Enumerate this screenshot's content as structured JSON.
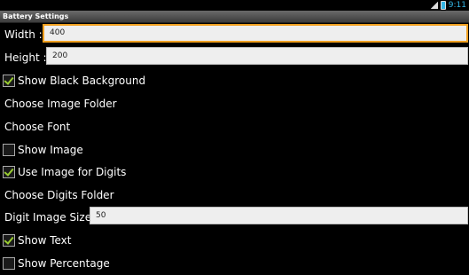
{
  "status_bar": {
    "time": "9:11",
    "signal_icon": "signal-icon",
    "battery_icon": "battery-icon"
  },
  "title": "Battery Settings",
  "width": {
    "label": "Width :",
    "value": "400"
  },
  "height": {
    "label": "Height :",
    "value": "200"
  },
  "show_black_background": {
    "label": "Show Black Background",
    "checked": true
  },
  "choose_image_folder": "Choose Image Folder",
  "choose_font": "Choose Font",
  "show_image": {
    "label": "Show Image",
    "checked": false
  },
  "use_image_for_digits": {
    "label": "Use Image for Digits",
    "checked": true
  },
  "choose_digits_folder": "Choose Digits Folder",
  "digit_image_size": {
    "label": "Digit Image Size :",
    "value": "50"
  },
  "show_text": {
    "label": "Show Text",
    "checked": true
  },
  "show_percentage": {
    "label": "Show Percentage",
    "checked": false
  },
  "colors": {
    "accent": "#f0a020",
    "check": "#9acd32",
    "title_bar": "#555555"
  }
}
